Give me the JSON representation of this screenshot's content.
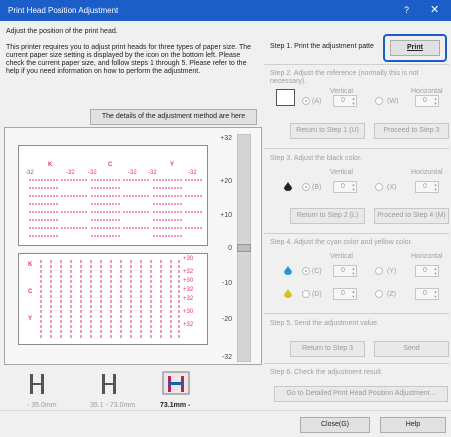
{
  "window": {
    "title": "Print Head Position Adjustment",
    "help_glyph": "?",
    "close_glyph": "✕"
  },
  "intro": {
    "line1": "Adjust the position of the print head.",
    "body": "This printer requires you to adjust print heads for three types of paper size. The current paper size setting is displayed by the icon on the bottom left. Please check the current paper size, and follow steps 1 through 5. Please refer to the help if you need information on how to perform the adjustment."
  },
  "details_button": "The details of the adjustment method are here",
  "scale": [
    "+32",
    "+20",
    "+10",
    "0",
    "-10",
    "-20",
    "-32"
  ],
  "sheet": {
    "top_labels": [
      "K",
      "C",
      "Y"
    ],
    "top_values": [
      "-32",
      "-32",
      "-32",
      "-32",
      "-32",
      "-32"
    ],
    "bottom_labels": [
      "K",
      "C",
      "Y"
    ],
    "right_values": [
      "+30",
      "+32",
      "+30",
      "+32",
      "+32",
      "+30",
      "+32"
    ]
  },
  "sizes": [
    {
      "label": "- 35.0mm",
      "active": false
    },
    {
      "label": "35.1 - 73.0mm",
      "active": false
    },
    {
      "label": "73.1mm -",
      "active": true
    }
  ],
  "step1": {
    "label": "Step 1. Print the adjustment patte",
    "button": "Print"
  },
  "step2": {
    "label": "Step 2. Adjust the reference (normally this is not necessary).",
    "vertical": "Vertical",
    "horizontal": "Horizontal",
    "radio_a": "(A)",
    "radio_w": "(W)",
    "val_a": "0",
    "val_w": "0",
    "back": "Return to Step 1 (U)",
    "next": "Proceed to Step 3"
  },
  "step3": {
    "label": "Step 3. Adjust the black color.",
    "vertical": "Vertical",
    "horizontal": "Horizontal",
    "radio_b": "(B)",
    "radio_x": "(X)",
    "val_b": "0",
    "val_x": "0",
    "back": "Return to Step 2 (L)",
    "next": "Proceed to Step 4 (M)"
  },
  "step4": {
    "label": "Step 4. Adjust the cyan color and yellow color.",
    "vertical": "Vertical",
    "horizontal": "Horizontal",
    "radio_c": "(C)",
    "radio_y": "(Y)",
    "val_c": "0",
    "val_y": "0",
    "radio_d": "(D)",
    "radio_z": "(Z)",
    "val_d": "0",
    "val_z": "0"
  },
  "step5": {
    "label": "Step 5. Send the adjustment value.",
    "back": "Return to Step 3",
    "send": "Send"
  },
  "step6": {
    "label": "Step 6. Check the adjustment result.",
    "button": "Go to Detailed Print Head Position Adjustment..."
  },
  "footer": {
    "close": "Close(G)",
    "help": "Help"
  },
  "colors": {
    "accent": "#1b5ec8",
    "pink": "#e2317c",
    "cyan": "#1e9ad6",
    "yellow": "#d6c21e"
  },
  "icons": [
    "printer-head-icon",
    "ink-drop-icon",
    "spin-arrows-icon"
  ]
}
